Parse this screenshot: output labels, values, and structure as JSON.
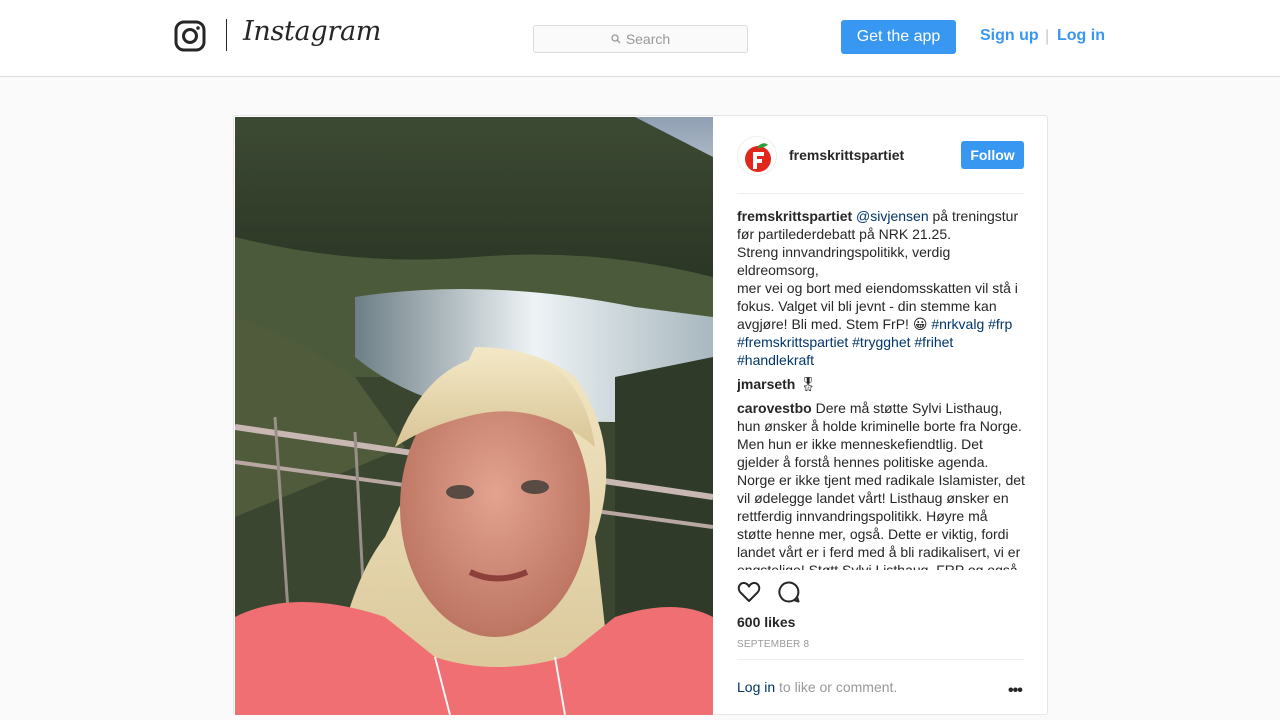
{
  "header": {
    "wordmark": "Instagram",
    "search_placeholder": "Search",
    "get_app_label": "Get the app",
    "signup_label": "Sign up",
    "separator": "|",
    "login_label": "Log in"
  },
  "post": {
    "username": "fremskrittspartiet",
    "follow_label": "Follow",
    "caption": {
      "user": "fremskrittspartiet",
      "mention": "@sivjensen",
      "text": " på treningstur før partilederdebatt på NRK 21.25.\nStreng innvandringspolitikk, verdig eldreomsorg,\nmer vei og bort med eiendomsskatten vil stå i fokus. Valget vil bli jevnt - din stemme kan avgjøre! Bli med. Stem FrP! 😀 ",
      "hashtags": "#nrkvalg #frp #fremskrittspartiet #trygghet #frihet #handlekraft"
    },
    "comments": [
      {
        "user": "jmarseth",
        "text": " 🎖"
      },
      {
        "user": "carovestbo",
        "text": " Dere må støtte Sylvi Listhaug, hun ønsker å holde kriminelle borte fra Norge. Men hun er ikke menneskefiendtlig. Det gjelder å forstå hennes politiske agenda. Norge er ikke tjent med radikale Islamister, det vil ødelegge landet vårt! Listhaug ønsker en rettferdig innvandringspolitikk. Høyre må støtte henne mer, også. Dette er viktig, fordi landet vårt er i ferd med å bli radikalisert, vi er engstelige! Støtt Sylvi Listhaug, FRP og også"
      }
    ],
    "likes": "600 likes",
    "date": "SEPTEMBER 8",
    "login_link": "Log in",
    "login_prompt_rest": " to like or comment.",
    "more_label": "•••"
  },
  "colors": {
    "accent": "#3897f0",
    "link": "#003569",
    "muted": "#999999",
    "border": "#dbdbdb"
  }
}
